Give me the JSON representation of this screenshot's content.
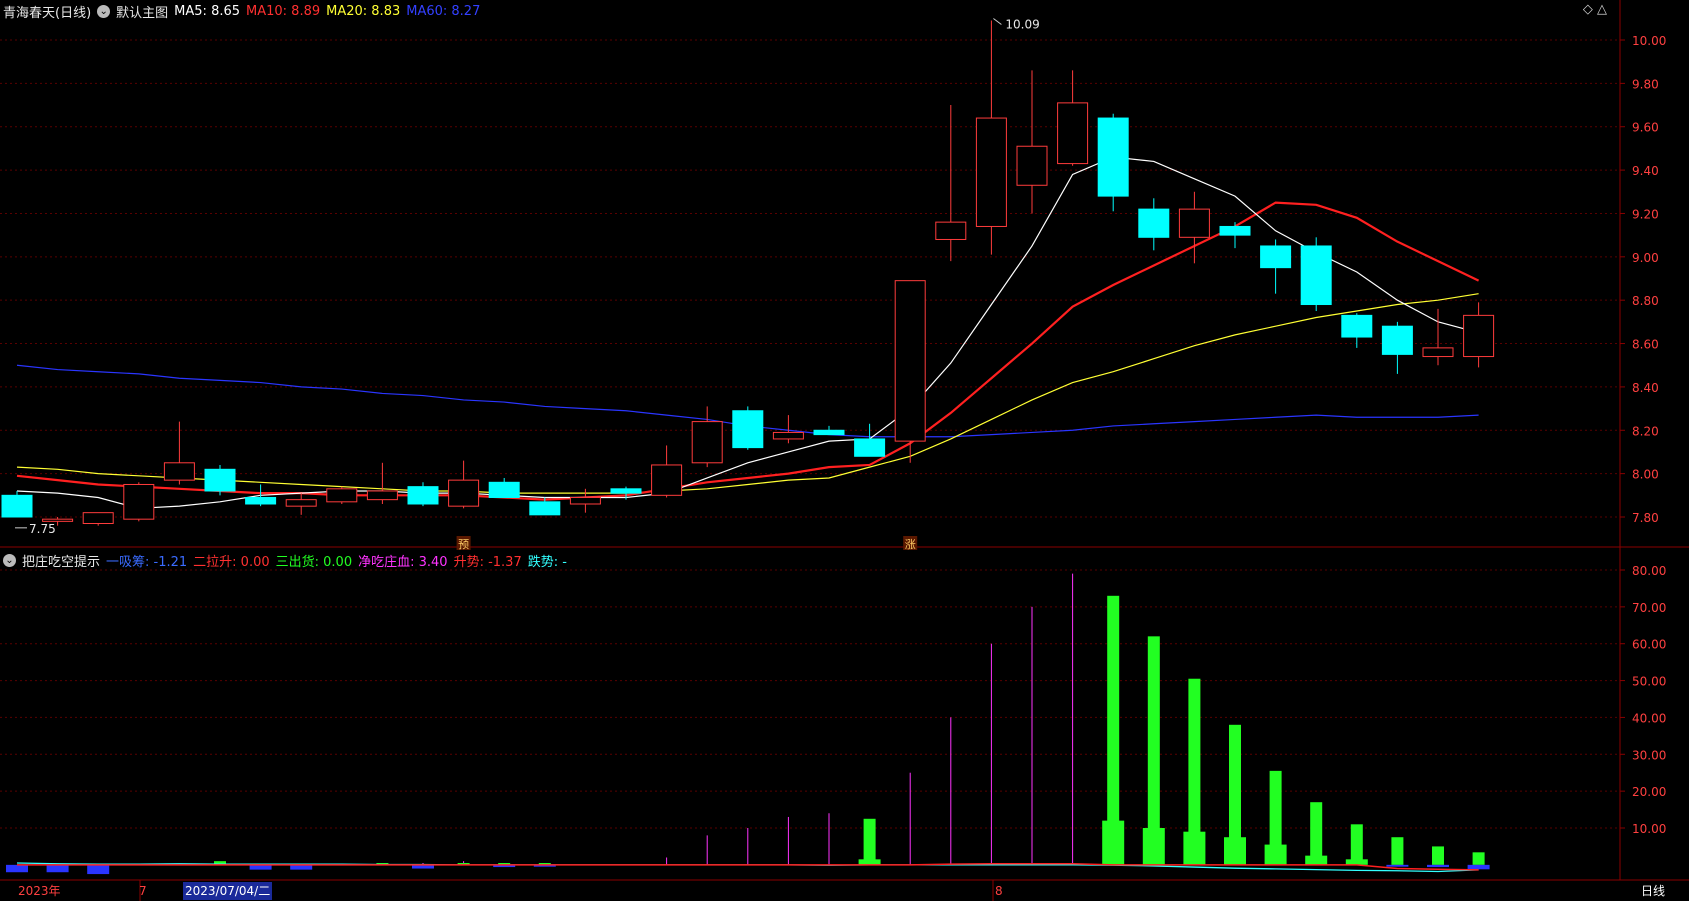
{
  "header": {
    "stock": "青海春天(日线)",
    "main_menu": "默认主图",
    "indicators": [
      {
        "label": "MA5: 8.65",
        "color": "#ffffff"
      },
      {
        "label": "MA10: 8.89",
        "color": "#ff3030"
      },
      {
        "label": "MA20: 8.83",
        "color": "#ffff33"
      },
      {
        "label": "MA60: 8.27",
        "color": "#3340ff"
      }
    ]
  },
  "sub_header": {
    "title": "把庄吃空提示",
    "items": [
      {
        "label": "一吸筹: -1.21",
        "color": "#3a6bff"
      },
      {
        "label": "二拉升: 0.00",
        "color": "#ff3030"
      },
      {
        "label": "三出货: 0.00",
        "color": "#22ff22"
      },
      {
        "label": "净吃庄血: 3.40",
        "color": "#ff33ff"
      },
      {
        "label": "升势: -1.37",
        "color": "#ff3030"
      },
      {
        "label": "跌势: -",
        "color": "#33ffff"
      }
    ]
  },
  "top_right_icons": "◇ △",
  "bottom_bar": {
    "year_label": "2023年",
    "month7": "7",
    "cursor_date": "2023/07/04/二",
    "month8": "8",
    "period": "日线"
  },
  "colors": {
    "up": "#ff3c3c",
    "down": "#00ffff",
    "ma5": "#ffffff",
    "ma10": "#ff2020",
    "ma20": "#ffff33",
    "ma60": "#2a35ff",
    "grid": "#5a0000",
    "axis": "#8a0000"
  },
  "chart_data": [
    {
      "type": "candlestick",
      "title": "青海春天(日线)",
      "ylim": [
        7.7,
        10.1
      ],
      "yticks": [
        "10.00",
        "9.80",
        "9.60",
        "9.40",
        "9.20",
        "9.00",
        "8.80",
        "8.60",
        "8.40",
        "8.20",
        "8.00",
        "7.80"
      ],
      "ytick_values": [
        10.0,
        9.8,
        9.6,
        9.4,
        9.2,
        9.0,
        8.8,
        8.6,
        8.4,
        8.2,
        8.0,
        7.8
      ],
      "candles": [
        {
          "o": 7.9,
          "h": 7.92,
          "l": 7.8,
          "c": 7.8
        },
        {
          "o": 7.78,
          "h": 7.8,
          "l": 7.76,
          "c": 7.79
        },
        {
          "o": 7.77,
          "h": 7.82,
          "l": 7.76,
          "c": 7.82
        },
        {
          "o": 7.79,
          "h": 7.96,
          "l": 7.78,
          "c": 7.95
        },
        {
          "o": 7.97,
          "h": 8.24,
          "l": 7.95,
          "c": 8.05
        },
        {
          "o": 8.02,
          "h": 8.04,
          "l": 7.9,
          "c": 7.92
        },
        {
          "o": 7.89,
          "h": 7.95,
          "l": 7.85,
          "c": 7.86
        },
        {
          "o": 7.85,
          "h": 7.91,
          "l": 7.81,
          "c": 7.88
        },
        {
          "o": 7.87,
          "h": 7.94,
          "l": 7.86,
          "c": 7.93
        },
        {
          "o": 7.88,
          "h": 8.05,
          "l": 7.86,
          "c": 7.92
        },
        {
          "o": 7.94,
          "h": 7.96,
          "l": 7.85,
          "c": 7.86
        },
        {
          "o": 7.85,
          "h": 8.06,
          "l": 7.84,
          "c": 7.97
        },
        {
          "o": 7.96,
          "h": 7.98,
          "l": 7.89,
          "c": 7.89
        },
        {
          "o": 7.87,
          "h": 7.89,
          "l": 7.81,
          "c": 7.81
        },
        {
          "o": 7.86,
          "h": 7.93,
          "l": 7.82,
          "c": 7.89
        },
        {
          "o": 7.93,
          "h": 7.94,
          "l": 7.88,
          "c": 7.91
        },
        {
          "o": 7.9,
          "h": 8.13,
          "l": 7.89,
          "c": 8.04
        },
        {
          "o": 8.05,
          "h": 8.31,
          "l": 8.03,
          "c": 8.24
        },
        {
          "o": 8.29,
          "h": 8.31,
          "l": 8.11,
          "c": 8.12
        },
        {
          "o": 8.16,
          "h": 8.27,
          "l": 8.14,
          "c": 8.19
        },
        {
          "o": 8.2,
          "h": 8.22,
          "l": 8.18,
          "c": 8.18
        },
        {
          "o": 8.16,
          "h": 8.23,
          "l": 8.08,
          "c": 8.08
        },
        {
          "o": 8.15,
          "h": 8.89,
          "l": 8.05,
          "c": 8.89
        },
        {
          "o": 9.08,
          "h": 9.7,
          "l": 8.98,
          "c": 9.16
        },
        {
          "o": 9.14,
          "h": 10.09,
          "l": 9.01,
          "c": 9.64
        },
        {
          "o": 9.33,
          "h": 9.86,
          "l": 9.2,
          "c": 9.51
        },
        {
          "o": 9.43,
          "h": 9.86,
          "l": 9.42,
          "c": 9.71
        },
        {
          "o": 9.64,
          "h": 9.66,
          "l": 9.21,
          "c": 9.28
        },
        {
          "o": 9.22,
          "h": 9.27,
          "l": 9.03,
          "c": 9.09
        },
        {
          "o": 9.09,
          "h": 9.3,
          "l": 8.97,
          "c": 9.22
        },
        {
          "o": 9.14,
          "h": 9.16,
          "l": 9.04,
          "c": 9.1
        },
        {
          "o": 9.05,
          "h": 9.08,
          "l": 8.83,
          "c": 8.95
        },
        {
          "o": 9.05,
          "h": 9.09,
          "l": 8.75,
          "c": 8.78
        },
        {
          "o": 8.73,
          "h": 8.74,
          "l": 8.58,
          "c": 8.63
        },
        {
          "o": 8.68,
          "h": 8.7,
          "l": 8.46,
          "c": 8.55
        },
        {
          "o": 8.54,
          "h": 8.76,
          "l": 8.5,
          "c": 8.58
        },
        {
          "o": 8.54,
          "h": 8.79,
          "l": 8.49,
          "c": 8.73
        }
      ],
      "ma5": [
        7.92,
        7.91,
        7.89,
        7.84,
        7.85,
        7.87,
        7.9,
        7.91,
        7.92,
        7.92,
        7.91,
        7.91,
        7.9,
        7.89,
        7.89,
        7.89,
        7.91,
        7.98,
        8.05,
        8.1,
        8.15,
        8.16,
        8.3,
        8.51,
        8.78,
        9.05,
        9.38,
        9.46,
        9.44,
        9.36,
        9.28,
        9.12,
        9.02,
        8.93,
        8.8,
        8.7,
        8.65
      ],
      "ma10": [
        7.99,
        7.97,
        7.95,
        7.94,
        7.93,
        7.92,
        7.91,
        7.91,
        7.9,
        7.9,
        7.9,
        7.9,
        7.89,
        7.88,
        7.89,
        7.9,
        7.93,
        7.96,
        7.98,
        8.0,
        8.03,
        8.04,
        8.14,
        8.28,
        8.44,
        8.6,
        8.77,
        8.87,
        8.96,
        9.05,
        9.14,
        9.25,
        9.24,
        9.18,
        9.07,
        8.98,
        8.89
      ],
      "ma20": [
        8.03,
        8.02,
        8.0,
        7.99,
        7.98,
        7.97,
        7.96,
        7.95,
        7.94,
        7.93,
        7.92,
        7.92,
        7.91,
        7.91,
        7.91,
        7.91,
        7.92,
        7.93,
        7.95,
        7.97,
        7.98,
        8.03,
        8.08,
        8.16,
        8.25,
        8.34,
        8.42,
        8.47,
        8.53,
        8.59,
        8.64,
        8.68,
        8.72,
        8.75,
        8.78,
        8.8,
        8.83
      ],
      "ma60": [
        8.5,
        8.48,
        8.47,
        8.46,
        8.44,
        8.43,
        8.42,
        8.4,
        8.39,
        8.37,
        8.36,
        8.34,
        8.33,
        8.31,
        8.3,
        8.29,
        8.27,
        8.25,
        8.22,
        8.2,
        8.18,
        8.17,
        8.17,
        8.17,
        8.18,
        8.19,
        8.2,
        8.22,
        8.23,
        8.24,
        8.25,
        8.26,
        8.27,
        8.26,
        8.26,
        8.26,
        8.27
      ],
      "annotations": [
        {
          "label": "10.09",
          "index": 24,
          "value": 10.09
        },
        {
          "label": "7.75",
          "index": 0,
          "value": 7.75
        }
      ],
      "markers": [
        {
          "label": "预",
          "index": 11
        },
        {
          "label": "涨",
          "index": 22
        }
      ]
    },
    {
      "type": "bar",
      "title": "把庄吃空提示",
      "ylim": [
        -3,
        83
      ],
      "yticks": [
        "80.00",
        "70.00",
        "60.00",
        "50.00",
        "40.00",
        "30.00",
        "20.00",
        "10.00"
      ],
      "ytick_values": [
        80,
        70,
        60,
        50,
        40,
        30,
        20,
        10
      ],
      "magenta_lines": [
        0,
        0,
        0,
        0,
        0,
        0,
        0,
        0,
        0,
        0,
        0.5,
        1,
        0.5,
        0.3,
        0,
        0,
        2,
        8,
        10,
        13,
        14,
        0,
        25,
        40,
        60,
        70,
        79,
        0,
        0,
        0,
        0,
        0,
        0,
        0,
        0,
        0,
        0
      ],
      "green_bars": [
        0,
        0,
        0,
        0,
        0,
        1,
        0,
        0,
        0,
        0.5,
        0,
        0.5,
        0.5,
        0.5,
        0,
        0,
        0,
        0,
        0,
        0,
        0,
        12.5,
        0,
        0,
        0,
        0,
        0,
        73,
        62,
        50.5,
        38,
        25.5,
        17,
        11,
        7.5,
        5,
        3.4
      ],
      "green_bars_short": [
        0,
        0,
        0,
        0,
        0,
        0,
        0,
        0,
        0,
        0,
        0,
        0,
        0,
        0,
        0,
        0,
        0,
        0,
        0,
        0,
        0,
        1.5,
        0,
        0,
        0,
        0,
        0,
        12,
        10,
        9,
        7.5,
        5.5,
        2.5,
        1.5,
        0,
        0,
        0
      ],
      "blue_bars": [
        -2,
        -2,
        -2.5,
        0,
        0,
        0,
        -1.3,
        -1.3,
        0,
        0,
        -1.0,
        0,
        -0.6,
        -0.5,
        0,
        0,
        0,
        0,
        0,
        0,
        0,
        0,
        0,
        0,
        0,
        0,
        0,
        0,
        0,
        0,
        0,
        0,
        0,
        0,
        -0.5,
        -0.6,
        -1.21
      ],
      "cyan_line": [
        0.5,
        0.3,
        0.2,
        0.2,
        0.3,
        0.2,
        0.2,
        0.2,
        0.2,
        0.1,
        0.1,
        0,
        0,
        0,
        0,
        0,
        0,
        0,
        0,
        0,
        -0.1,
        0,
        0,
        0,
        0,
        0,
        0,
        -0.1,
        -0.3,
        -0.6,
        -0.9,
        -1.1,
        -1.3,
        -1.5,
        -1.6,
        -1.8,
        -1.37
      ],
      "red_line": [
        0,
        0,
        0,
        0,
        0,
        0,
        0,
        0,
        0,
        0,
        0,
        0,
        0,
        0,
        0,
        0,
        0,
        0,
        0,
        0,
        0,
        0,
        0,
        0.2,
        0.3,
        0.3,
        0.3,
        0,
        0,
        0,
        0,
        0,
        0,
        0,
        -1.0,
        -1.2,
        -1.37
      ]
    }
  ]
}
